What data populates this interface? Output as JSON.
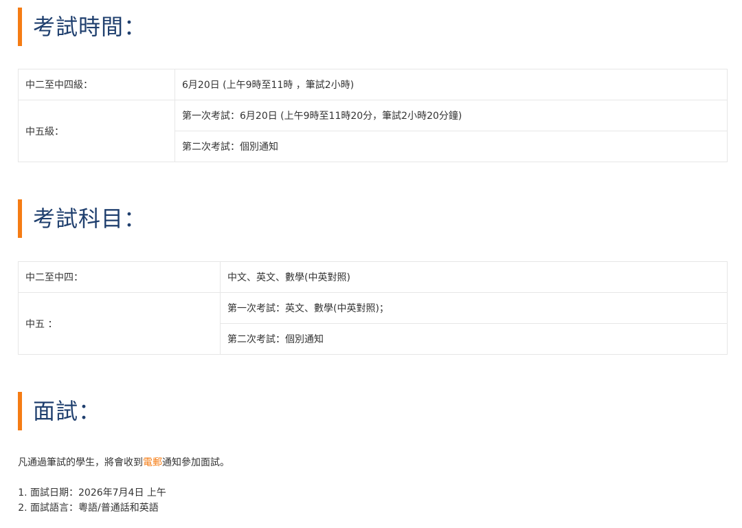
{
  "sections": {
    "exam_time": {
      "title": "考試時間：",
      "rows": [
        {
          "label": "中二至中四級：",
          "value": "6月20日 (上午9時至11時 ，筆試2小時)"
        },
        {
          "label": "中五級：",
          "values": [
            "第一次考試：6月20日 (上午9時至11時20分，筆試2小時20分鐘)",
            "第二次考試：個別通知"
          ]
        }
      ]
    },
    "exam_subjects": {
      "title": "考試科目：",
      "rows": [
        {
          "label": "中二至中四：",
          "value": "中文、英文、數學(中英對照)"
        },
        {
          "label": "中五 ：",
          "values": [
            "第一次考試：英文、數學(中英對照)；",
            "第二次考試：個別通知"
          ]
        }
      ]
    },
    "interview": {
      "title": "面試：",
      "intro_before": "凡通過筆試的學生，將會收到",
      "intro_highlight": "電郵",
      "intro_after": "通知參加面試。",
      "items": [
        "面試日期：2026年7月4日 上午",
        "面試語言：粵語/普通話和英語"
      ]
    }
  },
  "colors": {
    "accent": "#f57c14",
    "heading": "#1f3f6e",
    "text": "#333333",
    "border": "#e6e6e6"
  }
}
